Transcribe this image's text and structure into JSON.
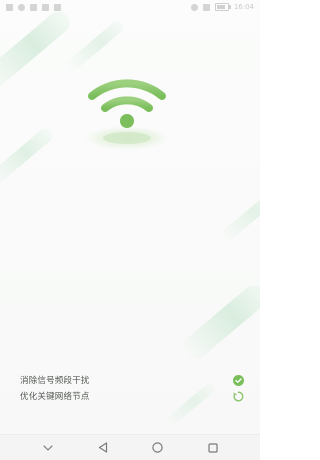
{
  "status_bar": {
    "left_icons": [
      "signal-icon",
      "wifi-status-icon",
      "app-notification-icon",
      "app-notification-icon",
      "app-notification-icon"
    ],
    "right_text": "16:04"
  },
  "illustration": {
    "icon": "wifi-icon",
    "accent_color": "#8ac46a",
    "glow_color": "#d9edd1"
  },
  "tasks": [
    {
      "label": "消除信号频段干扰",
      "status": "done",
      "status_icon": "check-circle-icon",
      "status_color": "#7bbf5c"
    },
    {
      "label": "优化关键网络节点",
      "status": "loading",
      "status_icon": "loading-spinner-icon",
      "status_color": "#8ac46a"
    }
  ],
  "nav_bar": {
    "items": [
      "hide-keyboard-icon",
      "back-icon",
      "home-icon",
      "recents-icon"
    ]
  }
}
